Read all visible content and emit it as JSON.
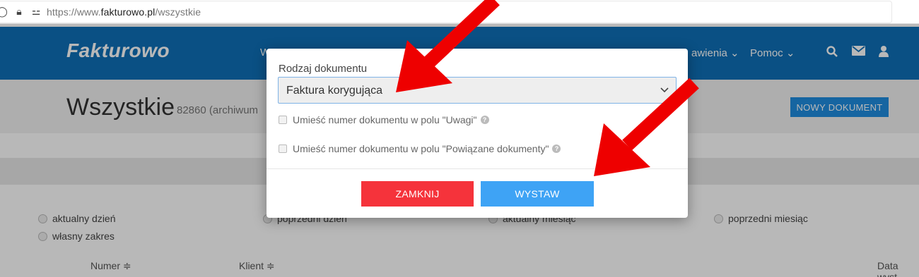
{
  "browser": {
    "scheme": "https://www.",
    "domain": "fakturowo.pl",
    "path": "/wszystkie"
  },
  "nav": {
    "logo": "Fakturowo",
    "partial_first": "W",
    "settings_partial": "awienia",
    "help": "Pomoc",
    "icons": [
      "search-icon",
      "mail-icon",
      "user-icon"
    ]
  },
  "page": {
    "title": "Wszystkie",
    "count_partial": "82860 (archiwum",
    "new_doc_button": "NOWY DOKUMENT"
  },
  "filters": {
    "today": "aktualny dzień",
    "custom_range": "własny zakres",
    "prev_day": "poprzedni dzień",
    "current_month": "aktualny miesiąc",
    "prev_month": "poprzedni miesiąc"
  },
  "table": {
    "col_number": "Numer ≑",
    "col_client": "Klient ≑",
    "col_date_partial": "Data wyst"
  },
  "modal": {
    "label": "Rodzaj dokumentu",
    "selected": "Faktura korygująca",
    "check1": "Umieść numer dokumentu w polu \"Uwagi\"",
    "check2": "Umieść numer dokumentu w polu \"Powiązane dokumenty\"",
    "close_button": "ZAMKNIJ",
    "issue_button": "WYSTAW"
  },
  "colors": {
    "navbar": "#0f70b7",
    "close": "#f5333b",
    "issue": "#3ea3f5",
    "arrow": "#ee0000"
  }
}
